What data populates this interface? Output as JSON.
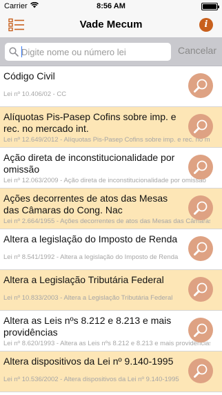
{
  "status_bar": {
    "carrier": "Carrier",
    "time": "8:56 AM",
    "battery_level": 1.0
  },
  "nav": {
    "title": "Vade Mecum",
    "menu_icon": "list-icon",
    "info_icon": "info-icon",
    "info_glyph": "i",
    "accent_color": "#c8601d"
  },
  "search": {
    "placeholder": "Digite nome ou número lei",
    "value": "",
    "cancel_label": "Cancelar"
  },
  "colors": {
    "row_alt_background": "#fde6b6",
    "row_button": "#dea283"
  },
  "items": [
    {
      "title": "Código Civil",
      "subtitle": "Lei nº 10.406/02 - CC",
      "highlighted": false
    },
    {
      "title": "Alíquotas Pis-Pasep Cofins sobre imp. e rec. no mercado int.",
      "subtitle": "Lei nº 12.649/2012 - Alíquotas Pis-Pasep Cofins sobre imp. e rec. no mercado int.",
      "highlighted": true
    },
    {
      "title": "Ação direta de inconstitucionalidade por omissão",
      "subtitle": "Lei nº 12.063/2009 - Ação direta de inconstitucionalidade por omissão",
      "highlighted": false
    },
    {
      "title": "Ações decorrentes de atos das Mesas das Câmaras do Cong. Nac",
      "subtitle": "Lei nº 2.664/1955 - Ações decorrentes de atos das Mesas das Câmaras do Cong. Nac",
      "highlighted": true
    },
    {
      "title": "Altera a legislação do Imposto de Renda",
      "subtitle": "Lei nº 8.541/1992 - Altera a legislação do Imposto de Renda",
      "highlighted": false
    },
    {
      "title": "Altera a Legislação Tributária Federal",
      "subtitle": "Lei nº 10.833/2003 - Altera a Legislação Tributária Federal",
      "highlighted": true
    },
    {
      "title": "Altera as Leis nºs 8.212 e 8.213 e mais providências",
      "subtitle": "Lei nº 8.620/1993 - Altera as Leis nºs 8.212 e 8.213 e mais providências",
      "highlighted": false
    },
    {
      "title": "Altera dispositivos da Lei nº 9.140-1995",
      "subtitle": "Lei nº 10.536/2002 - Altera dispositivos da Lei nº 9.140-1995",
      "highlighted": true
    }
  ]
}
